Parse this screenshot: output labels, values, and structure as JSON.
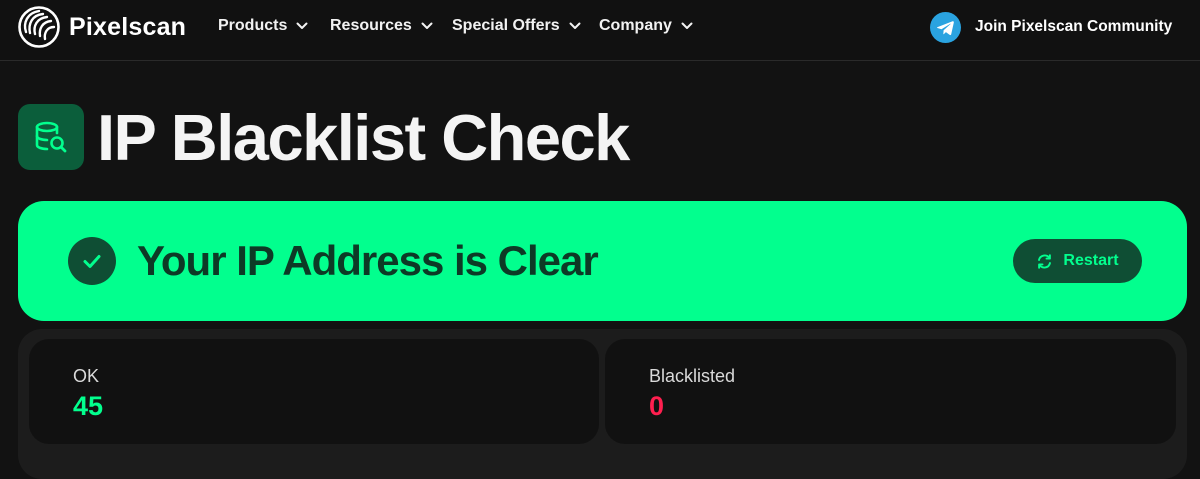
{
  "header": {
    "logo_text": "Pixelscan",
    "nav": [
      {
        "label": "Products"
      },
      {
        "label": "Resources"
      },
      {
        "label": "Special Offers"
      },
      {
        "label": "Company"
      }
    ],
    "community_label": "Join Pixelscan Community",
    "community_icon": "telegram-icon"
  },
  "page": {
    "title": "IP Blacklist Check",
    "title_icon": "database-search-icon"
  },
  "result": {
    "message": "Your IP Address is Clear",
    "status_icon": "check-icon",
    "restart_label": "Restart",
    "restart_icon": "refresh-icon"
  },
  "stats": {
    "ok_label": "OK",
    "ok_value": "45",
    "blacklisted_label": "Blacklisted",
    "blacklisted_value": "0"
  },
  "colors": {
    "accent": "#02ff8e",
    "accent_dark": "#0f4e34",
    "danger": "#ff1f4f",
    "background": "#121212"
  }
}
